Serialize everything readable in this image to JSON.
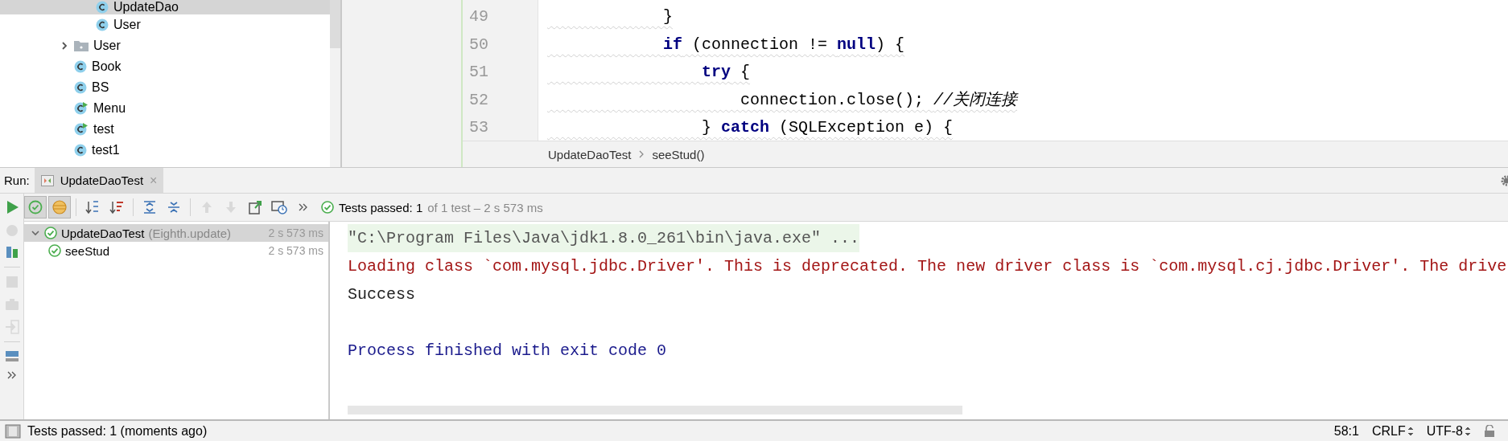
{
  "project_tree": {
    "continued_children": [
      {
        "kind": "class",
        "label": "UpdateDao",
        "selected": true
      },
      {
        "kind": "class",
        "label": "User",
        "selected": false
      }
    ],
    "items": [
      {
        "kind": "package",
        "label": "User",
        "expanded": false,
        "selected": false
      },
      {
        "kind": "class",
        "label": "Book",
        "selected": false
      },
      {
        "kind": "class",
        "label": "BS",
        "selected": false
      },
      {
        "kind": "runnable",
        "label": "Menu",
        "selected": false
      },
      {
        "kind": "runnable",
        "label": "test",
        "selected": false
      },
      {
        "kind": "class",
        "label": "test1",
        "selected": false
      }
    ]
  },
  "editor": {
    "lines": [
      {
        "number": "49",
        "code": "            }"
      },
      {
        "number": "50",
        "code": "            **if** (connection != **null**) {"
      },
      {
        "number": "51",
        "code": "                **try** {"
      },
      {
        "number": "52",
        "code": "                    connection.close(); *//关闭连接*"
      },
      {
        "number": "53",
        "code": "                } **catch** (SQLException e) {"
      }
    ],
    "breadcrumbs": [
      "UpdateDaoTest",
      "seeStud()"
    ]
  },
  "run_panel": {
    "label": "Run:",
    "tabs": [
      {
        "label": "UpdateDaoTest",
        "close": "×",
        "selected": true
      }
    ],
    "side_tools": [
      {
        "kind": "run",
        "disabled": false
      },
      {
        "kind": "debug",
        "disabled": true
      },
      {
        "kind": "coverage",
        "disabled": false
      },
      {
        "kind": "stop",
        "disabled": true
      },
      {
        "kind": "snapshot",
        "disabled": true
      },
      {
        "kind": "exit",
        "disabled": true
      },
      {
        "kind": "layout",
        "disabled": false
      },
      {
        "kind": "more",
        "disabled": false
      }
    ],
    "toolbar_groups": [
      {
        "buttons": [
          {
            "kind": "show-passed",
            "pressed": true,
            "disabled": false
          },
          {
            "kind": "show-ignored",
            "pressed": true,
            "disabled": false
          }
        ]
      },
      {
        "buttons": [
          {
            "kind": "sort-alpha",
            "pressed": false,
            "disabled": false
          },
          {
            "kind": "sort-duration",
            "pressed": false,
            "disabled": false
          }
        ]
      },
      {
        "buttons": [
          {
            "kind": "expand-all",
            "pressed": false,
            "disabled": false
          },
          {
            "kind": "collapse-all",
            "pressed": false,
            "disabled": false
          }
        ]
      },
      {
        "buttons": [
          {
            "kind": "previous",
            "pressed": false,
            "disabled": true
          },
          {
            "kind": "next",
            "pressed": false,
            "disabled": true
          },
          {
            "kind": "export",
            "pressed": false,
            "disabled": false
          },
          {
            "kind": "history",
            "pressed": false,
            "disabled": false
          },
          {
            "kind": "more",
            "pressed": false,
            "disabled": false
          }
        ]
      }
    ],
    "summary": {
      "passed": true,
      "text": "Tests passed: 1",
      "detail": "of 1 test – 2 s 573 ms"
    },
    "tests": [
      {
        "name": "UpdateDaoTest",
        "context": "(Eighth.update)",
        "time": "2 s 573 ms",
        "passed": true,
        "expanded": true,
        "selected": true,
        "children": [
          {
            "name": "seeStud",
            "time": "2 s 573 ms",
            "passed": true,
            "selected": false
          }
        ]
      }
    ],
    "console": [
      {
        "kind": "command",
        "text": "\"C:\\Program Files\\Java\\jdk1.8.0_261\\bin\\java.exe\" ..."
      },
      {
        "kind": "stderr",
        "text": "Loading class `com.mysql.jdbc.Driver'. This is deprecated. The new driver class is `com.mysql.cj.jdbc.Driver'. The drive"
      },
      {
        "kind": "stdout",
        "text": "Success"
      },
      {
        "kind": "exit",
        "text": "Process finished with exit code 0"
      }
    ]
  },
  "status_bar": {
    "message": "Tests passed: 1 (moments ago)",
    "position": "58:1",
    "line_separator": "CRLF",
    "encoding": "UTF-8",
    "read_only": false
  }
}
